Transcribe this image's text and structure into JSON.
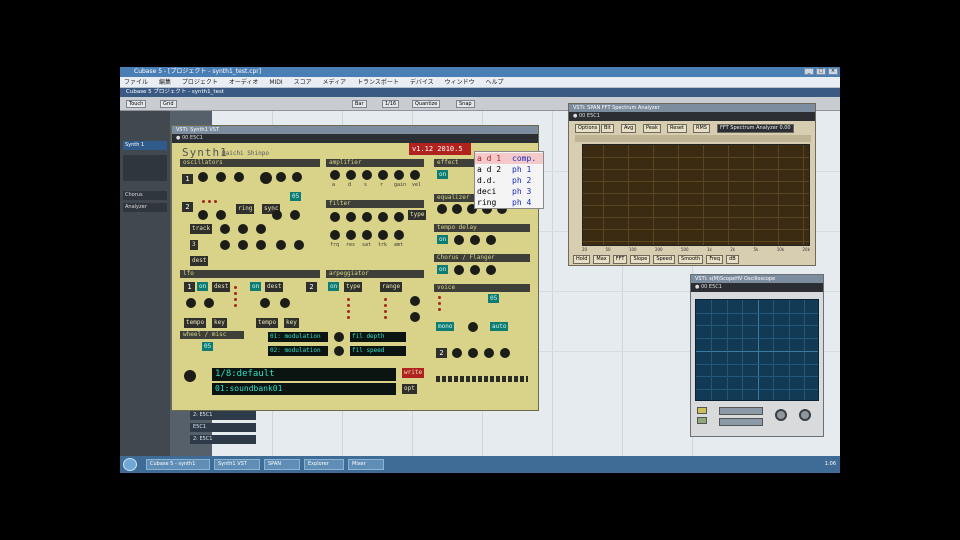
{
  "window": {
    "title": "Cubase 5 - [プロジェクト - synth1_test.cpr]",
    "controls": [
      "_",
      "□",
      "×"
    ]
  },
  "menubar": [
    "ファイル",
    "編集",
    "プロジェクト",
    "オーディオ",
    "MIDI",
    "スコア",
    "メディア",
    "トランスポート",
    "デバイス",
    "ウィンドウ",
    "ヘルプ"
  ],
  "project_title": "Cubase 5 プロジェクト - synth1_test",
  "toolbar": [
    "Touch",
    "Grid",
    "Bar",
    "1/16",
    "Quantize",
    "Snap"
  ],
  "tracks": [
    "Synth 1",
    "Chorus",
    "Analyzer"
  ],
  "lane_entries": [
    "2: E5C1",
    "E5C1",
    "2: E5C1"
  ],
  "synth": {
    "window_title": "VSTi: Synth1 VST",
    "subbar": "● 00 E5C1",
    "title": "Synth1",
    "subtitle": "Daichi Shinpo",
    "version": "v1.12 2010.5",
    "sections": {
      "oscillators": "oscillators",
      "amplifier": "amplifier",
      "filter": "filter",
      "lfo": "lfo",
      "arpeggiator": "arpeggiator",
      "voice": "voice",
      "effect": "effect",
      "equalizer": "equalizer",
      "tempo_delay": "tempo delay",
      "chorus": "Chorus / Flanger",
      "wheel": "wheel / misc"
    },
    "buttons": {
      "ring": "ring",
      "sync": "sync",
      "track": "track",
      "dest": "dest",
      "type": "type",
      "range": "range",
      "on": "on",
      "dest1": "dest",
      "dest2": "dest",
      "tempo1": "tempo",
      "tempo2": "tempo",
      "key": "key",
      "auto": "auto",
      "mono": "mono",
      "mode": "mode",
      "opt": "opt",
      "write": "write"
    },
    "osc_nums": [
      "1",
      "2",
      "3"
    ],
    "lfo_nums": [
      "1",
      "2"
    ],
    "voice_num": "2",
    "counter": "05",
    "knob_labels": [
      "a",
      "d",
      "s",
      "r",
      "gain",
      "vel"
    ],
    "filter_labels": [
      "frq",
      "res",
      "sat",
      "trk",
      "amt"
    ],
    "lcd1": "1/8:default",
    "lcd2": "01:soundbank01",
    "lcd_src1": "01: modulation",
    "lcd_src2": "02: modulation",
    "lcd_dst1": "fil depth",
    "lcd_dst2": "fil speed",
    "popup": [
      {
        "a": "a d 1",
        "b": "comp."
      },
      {
        "a": "a d 2",
        "b": "ph 1"
      },
      {
        "a": "d.d.",
        "b": "ph 2"
      },
      {
        "a": "deci",
        "b": "ph 3"
      },
      {
        "a": "ring",
        "b": "ph 4"
      }
    ]
  },
  "analyzer": {
    "window_title": "VSTi: SPAN FFT Spectrum Analyzer",
    "subbar": "● 00 E5C1",
    "buttons": [
      "Options",
      "Bit",
      "Avg",
      "Peak",
      "Reset",
      "RMS",
      "FFT Spectrum Analyzer 0.00"
    ],
    "freq_labels": [
      "20",
      "50",
      "100",
      "200",
      "500",
      "1k",
      "2k",
      "5k",
      "10k",
      "20k"
    ],
    "bottom": [
      "Hold",
      "Max",
      "FFT",
      "Slope",
      "Speed",
      "Smooth",
      "Freq",
      "dB"
    ]
  },
  "scope": {
    "window_title": "VSTi: s(M)ScopeHV Oscilloscope",
    "subbar": "● 00 E5C1"
  },
  "taskbar": {
    "tasks": [
      "Cubase 5 - synth1",
      "Synth1 VST",
      "SPAN",
      "Explorer",
      "Mixer"
    ],
    "clock": "1:06"
  },
  "colors": {
    "synth_panel": "#d9d38a",
    "teal": "#0f7c74",
    "red": "#b0221e",
    "analyzer_plot": "#3b2b12",
    "scope_plot": "#123a55"
  }
}
